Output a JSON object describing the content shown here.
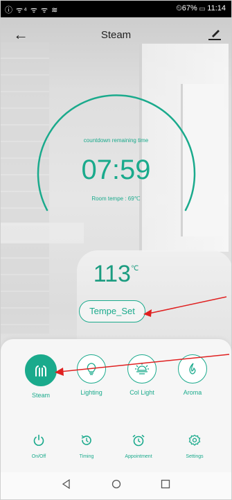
{
  "status_bar": {
    "left": "ⓘ ᯤ⁴ ᯤ ᯤ ≋",
    "right": "⏲67% ▭ 11:14"
  },
  "header": {
    "title": "Steam"
  },
  "dial": {
    "countdown_label": "countdown remaining time",
    "time": "07:59",
    "room_temp": "Room tempe : 69℃"
  },
  "temperature": {
    "value": "113",
    "unit": "℃"
  },
  "tempe_set_button": "Tempe_Set",
  "modes": [
    {
      "label": "Steam",
      "icon": "steam-icon",
      "active": true
    },
    {
      "label": "Lighting",
      "icon": "bulb-icon",
      "active": false
    },
    {
      "label": "Col Light",
      "icon": "sun-light-icon",
      "active": false
    },
    {
      "label": "Aroma",
      "icon": "leaf-drop-icon",
      "active": false
    }
  ],
  "bottom_bar": [
    {
      "label": "On/Off",
      "icon": "power-icon"
    },
    {
      "label": "Timing",
      "icon": "timer-icon"
    },
    {
      "label": "Appointment",
      "icon": "alarm-clock-icon"
    },
    {
      "label": "Settings",
      "icon": "gear-icon"
    }
  ],
  "colors": {
    "accent": "#1aaa8c",
    "annotation": "#e02020"
  }
}
